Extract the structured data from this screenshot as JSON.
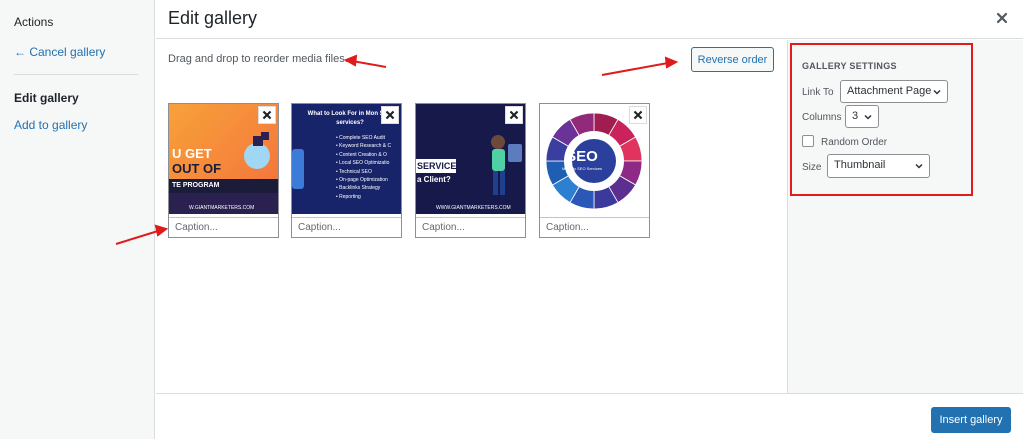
{
  "menu": {
    "heading": "Actions",
    "cancel_link": "← Cancel gallery",
    "active_item": "Edit gallery",
    "add_link": "Add to gallery"
  },
  "modal": {
    "title": "Edit gallery",
    "instructions": "Drag and drop to reorder media files.",
    "reverse_button": "Reverse order"
  },
  "thumbnails": [
    {
      "caption_placeholder": "Caption...",
      "image": {
        "line1": "U GET",
        "line2": "OUT OF",
        "line3": "TE PROGRAM",
        "footer": "W.GIANTMARKETERS.COM"
      }
    },
    {
      "caption_placeholder": "Caption...",
      "image": {
        "title": "What to Look For in Mon SEO services?",
        "items": [
          "Complete SEO Audit",
          "Keyword Research & C",
          "Content Creation & O",
          "Local SEO Optimizatio",
          "Technical SEO",
          "On-page Optimization",
          "Backlinks Strategy",
          "Reporting"
        ]
      }
    },
    {
      "caption_placeholder": "Caption...",
      "image": {
        "word": "SERVICE",
        "sub": "a Client?",
        "footer": "WWW.GIANTMARKETERS.COM"
      }
    },
    {
      "caption_placeholder": "Caption...",
      "image": {
        "center": "SEO",
        "center_sub": "Monthly SEO Services"
      }
    }
  ],
  "settings": {
    "heading": "GALLERY SETTINGS",
    "link_to_label": "Link To",
    "link_to_value": "Attachment Page",
    "columns_label": "Columns",
    "columns_value": "3",
    "random_label": "Random Order",
    "size_label": "Size",
    "size_value": "Thumbnail"
  },
  "footer": {
    "insert_button": "Insert gallery"
  },
  "colors": {
    "accent": "#2271b1",
    "annotation": "#e01b1b"
  }
}
